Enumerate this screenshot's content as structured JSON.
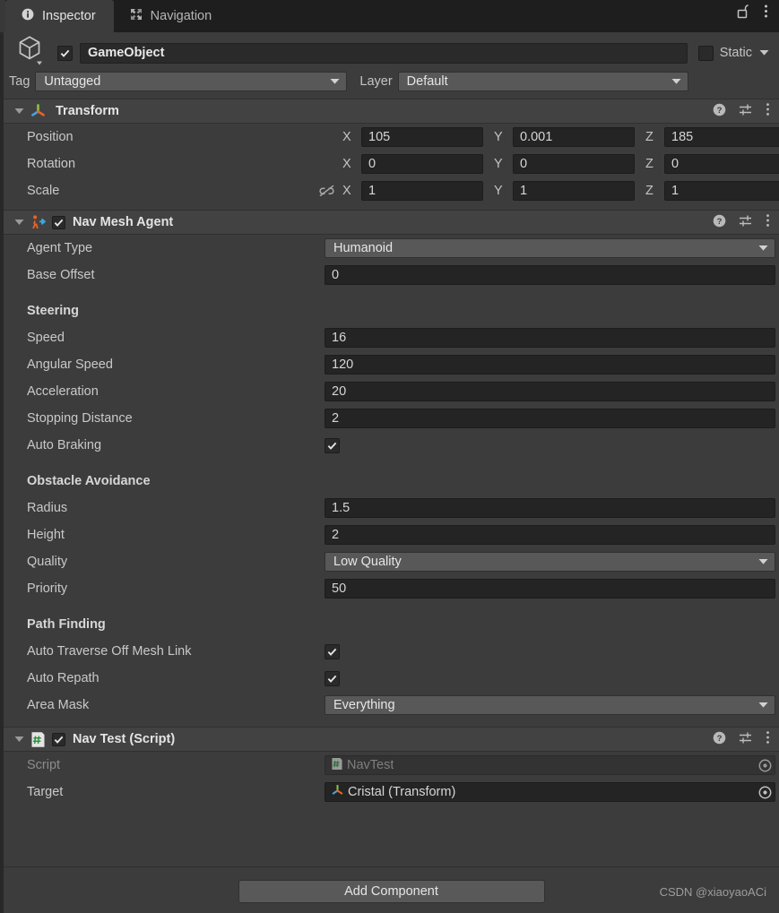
{
  "window": {
    "tabs": [
      {
        "label": "Inspector",
        "icon": "info-icon",
        "active": true
      },
      {
        "label": "Navigation",
        "icon": "move-expand-icon",
        "active": false
      }
    ],
    "lock_icon": "lock-open-icon",
    "menu_icon": "kebab-menu-icon"
  },
  "object_header": {
    "icon": "cube-icon",
    "enabled": true,
    "name": "GameObject",
    "static_label": "Static",
    "static_checked": false,
    "tag_label": "Tag",
    "tag_value": "Untagged",
    "layer_label": "Layer",
    "layer_value": "Default"
  },
  "components": [
    {
      "title": "Transform",
      "icon": "transform-gizmo-icon",
      "has_enable_toggle": false,
      "expanded": true,
      "rows": [
        {
          "label": "Position",
          "type": "vector3",
          "x": "105",
          "y": "0.001",
          "z": "185"
        },
        {
          "label": "Rotation",
          "type": "vector3",
          "x": "0",
          "y": "0",
          "z": "0"
        },
        {
          "label": "Scale",
          "type": "vector3",
          "x": "1",
          "y": "1",
          "z": "1",
          "link_icon": "constrain-proportions-off-icon"
        }
      ],
      "axis_labels": {
        "x": "X",
        "y": "Y",
        "z": "Z"
      },
      "tools": {
        "help": "help-icon",
        "preset": "preset-settings-icon",
        "menu": "kebab-menu-icon"
      }
    },
    {
      "title": "Nav Mesh Agent",
      "icon": "navmesh-agent-icon",
      "has_enable_toggle": true,
      "enabled": true,
      "expanded": true,
      "rows": [
        {
          "label": "Agent Type",
          "type": "popup",
          "value": "Humanoid"
        },
        {
          "label": "Base Offset",
          "type": "text",
          "value": "0"
        },
        {
          "type": "spacer"
        },
        {
          "label": "Steering",
          "type": "group"
        },
        {
          "label": "Speed",
          "type": "text",
          "value": "16"
        },
        {
          "label": "Angular Speed",
          "type": "text",
          "value": "120"
        },
        {
          "label": "Acceleration",
          "type": "text",
          "value": "20"
        },
        {
          "label": "Stopping Distance",
          "type": "text",
          "value": "2"
        },
        {
          "label": "Auto Braking",
          "type": "checkbox",
          "value": true
        },
        {
          "type": "spacer"
        },
        {
          "label": "Obstacle Avoidance",
          "type": "group"
        },
        {
          "label": "Radius",
          "type": "text",
          "value": "1.5"
        },
        {
          "label": "Height",
          "type": "text",
          "value": "2"
        },
        {
          "label": "Quality",
          "type": "popup",
          "value": "Low Quality"
        },
        {
          "label": "Priority",
          "type": "text",
          "value": "50"
        },
        {
          "type": "spacer"
        },
        {
          "label": "Path Finding",
          "type": "group"
        },
        {
          "label": "Auto Traverse Off Mesh Link",
          "type": "checkbox",
          "value": true
        },
        {
          "label": "Auto Repath",
          "type": "checkbox",
          "value": true
        },
        {
          "label": "Area Mask",
          "type": "popup",
          "value": "Everything"
        }
      ],
      "tools": {
        "help": "help-icon",
        "preset": "preset-settings-icon",
        "menu": "kebab-menu-icon"
      }
    },
    {
      "title": "Nav Test (Script)",
      "icon": "cs-script-icon",
      "has_enable_toggle": true,
      "enabled": true,
      "expanded": true,
      "rows": [
        {
          "label": "Script",
          "type": "object",
          "value": "NavTest",
          "value_icon": "cs-script-icon",
          "disabled": true
        },
        {
          "label": "Target",
          "type": "object",
          "value": "Cristal (Transform)",
          "value_icon": "transform-gizmo-icon",
          "disabled": false
        }
      ],
      "tools": {
        "help": "help-icon",
        "preset": "preset-settings-icon",
        "menu": "kebab-menu-icon"
      }
    }
  ],
  "footer": {
    "add_component_label": "Add Component",
    "watermark": "CSDN @xiaoyaoACi"
  },
  "colors": {
    "window_bg": "#383838",
    "panel_bg": "#3c3c3c",
    "comp_header_bg": "#424242",
    "tabbar_bg": "#1e1e1e",
    "field_bg": "#242424",
    "popup_bg": "#585858",
    "text": "#c9c9c9",
    "accent_orange": "#e8622a",
    "accent_blue": "#3ea8e0",
    "accent_green": "#8ac441"
  }
}
